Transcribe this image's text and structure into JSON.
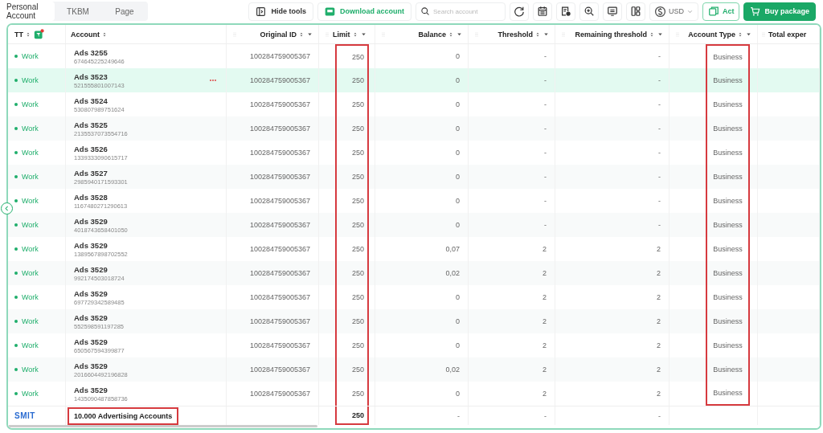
{
  "tabs": [
    {
      "label": "Personal Account",
      "selected": true
    },
    {
      "label": "TKBM",
      "selected": false
    },
    {
      "label": "Page",
      "selected": false
    }
  ],
  "toolbar": {
    "hide_tools": "Hide tools",
    "download": "Download account",
    "search": {
      "placeholder": "Search account"
    },
    "currency": "USD",
    "act": "Act",
    "buy": "Buy package"
  },
  "table": {
    "columns": [
      {
        "label": "TT",
        "filter": true,
        "menu": false,
        "highlight": false
      },
      {
        "label": "Account",
        "filter": false,
        "menu": false,
        "highlight": false
      },
      {
        "label": "Original ID",
        "filter": false,
        "menu": true,
        "highlight": false
      },
      {
        "label": "Limit",
        "filter": false,
        "menu": true,
        "highlight": true
      },
      {
        "label": "Balance",
        "filter": false,
        "menu": true,
        "highlight": false
      },
      {
        "label": "Threshold",
        "filter": false,
        "menu": true,
        "highlight": false
      },
      {
        "label": "Remaining threshold",
        "filter": false,
        "menu": true,
        "highlight": false
      },
      {
        "label": "Account Type",
        "filter": false,
        "menu": true,
        "highlight": true
      },
      {
        "label": "Total exper",
        "filter": false,
        "menu": false,
        "highlight": false
      }
    ],
    "rows": [
      {
        "status": "Work",
        "name": "Ads 3255",
        "id": "674645225249646",
        "original_id": "100284759005367",
        "limit": "250",
        "balance": "0",
        "threshold": "-",
        "remaining": "-",
        "type": "Business",
        "selected": false
      },
      {
        "status": "Work",
        "name": "Ads 3523",
        "id": "521555801007143",
        "original_id": "100284759005367",
        "limit": "250",
        "balance": "0",
        "threshold": "-",
        "remaining": "-",
        "type": "Business",
        "selected": true
      },
      {
        "status": "Work",
        "name": "Ads 3524",
        "id": "530807989751624",
        "original_id": "100284759005367",
        "limit": "250",
        "balance": "0",
        "threshold": "-",
        "remaining": "-",
        "type": "Business",
        "selected": false
      },
      {
        "status": "Work",
        "name": "Ads 3525",
        "id": "2135537073554716",
        "original_id": "100284759005367",
        "limit": "250",
        "balance": "0",
        "threshold": "-",
        "remaining": "-",
        "type": "Business",
        "selected": false
      },
      {
        "status": "Work",
        "name": "Ads 3526",
        "id": "1339333090615717",
        "original_id": "100284759005367",
        "limit": "250",
        "balance": "0",
        "threshold": "-",
        "remaining": "-",
        "type": "Business",
        "selected": false
      },
      {
        "status": "Work",
        "name": "Ads 3527",
        "id": "2985940171593301",
        "original_id": "100284759005367",
        "limit": "250",
        "balance": "0",
        "threshold": "-",
        "remaining": "-",
        "type": "Business",
        "selected": false
      },
      {
        "status": "Work",
        "name": "Ads 3528",
        "id": "1167480271290613",
        "original_id": "100284759005367",
        "limit": "250",
        "balance": "0",
        "threshold": "-",
        "remaining": "-",
        "type": "Business",
        "selected": false
      },
      {
        "status": "Work",
        "name": "Ads 3529",
        "id": "4018743658401050",
        "original_id": "100284759005367",
        "limit": "250",
        "balance": "0",
        "threshold": "-",
        "remaining": "-",
        "type": "Business",
        "selected": false
      },
      {
        "status": "Work",
        "name": "Ads 3529",
        "id": "1389567898702552",
        "original_id": "100284759005367",
        "limit": "250",
        "balance": "0,07",
        "threshold": "2",
        "remaining": "2",
        "type": "Business",
        "selected": false
      },
      {
        "status": "Work",
        "name": "Ads 3529",
        "id": "992174503018724",
        "original_id": "100284759005367",
        "limit": "250",
        "balance": "0,02",
        "threshold": "2",
        "remaining": "2",
        "type": "Business",
        "selected": false
      },
      {
        "status": "Work",
        "name": "Ads 3529",
        "id": "697729342589485",
        "original_id": "100284759005367",
        "limit": "250",
        "balance": "0",
        "threshold": "2",
        "remaining": "2",
        "type": "Business",
        "selected": false
      },
      {
        "status": "Work",
        "name": "Ads 3529",
        "id": "552598591197285",
        "original_id": "100284759005367",
        "limit": "250",
        "balance": "0",
        "threshold": "2",
        "remaining": "2",
        "type": "Business",
        "selected": false
      },
      {
        "status": "Work",
        "name": "Ads 3529",
        "id": "650567594399877",
        "original_id": "100284759005367",
        "limit": "250",
        "balance": "0",
        "threshold": "2",
        "remaining": "2",
        "type": "Business",
        "selected": false
      },
      {
        "status": "Work",
        "name": "Ads 3529",
        "id": "2016604492196828",
        "original_id": "100284759005367",
        "limit": "250",
        "balance": "0,02",
        "threshold": "2",
        "remaining": "2",
        "type": "Business",
        "selected": false
      },
      {
        "status": "Work",
        "name": "Ads 3529",
        "id": "1435090487858736",
        "original_id": "100284759005367",
        "limit": "250",
        "balance": "0",
        "threshold": "2",
        "remaining": "2",
        "type": "Business",
        "selected": false
      }
    ],
    "footer": [
      {
        "kind": "logo",
        "text": "SMIT"
      },
      {
        "kind": "label",
        "text": "10.000 Advertising Accounts",
        "highlight": true
      },
      {
        "kind": "value",
        "text": "250",
        "highlight": true
      },
      {
        "kind": "value",
        "text": "-",
        "highlight": false
      },
      {
        "kind": "value",
        "text": "-",
        "highlight": false
      },
      {
        "kind": "value",
        "text": "-",
        "highlight": false
      }
    ]
  }
}
